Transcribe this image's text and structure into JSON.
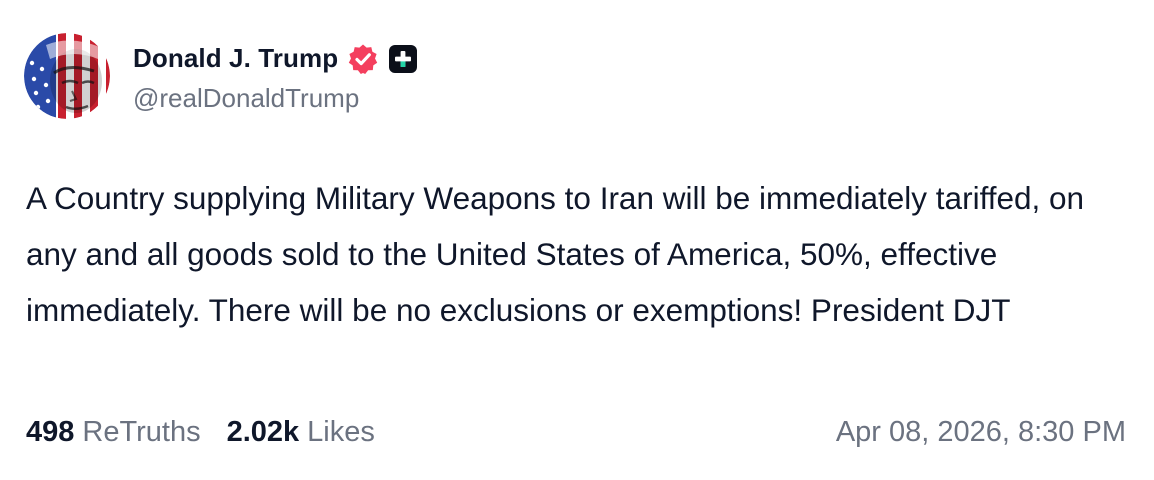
{
  "author": {
    "display_name": "Donald J. Trump",
    "handle": "@realDonaldTrump",
    "avatar_icon": "flag-portrait-avatar",
    "verified_icon": "verified-badge-icon",
    "plus_icon": "truth-plus-icon"
  },
  "post": {
    "text": "A Country supplying Military Weapons to Iran will be immediately tariffed, on any and all goods sold to the United States of America, 50%, effective immediately. There will be no exclusions or exemptions! President DJT"
  },
  "stats": {
    "retruths_count": "498",
    "retruths_label": "ReTruths",
    "likes_count": "2.02k",
    "likes_label": "Likes"
  },
  "timestamp": "Apr 08, 2026, 8:30 PM",
  "colors": {
    "verified_badge": "#f43f5e",
    "text_primary": "#0f172a",
    "text_secondary": "#6b7280"
  }
}
